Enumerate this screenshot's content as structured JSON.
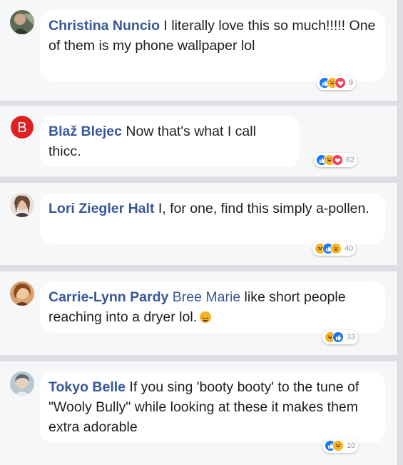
{
  "comments": [
    {
      "author": "Christina Nuncio",
      "text": " I literally love this so much!!!!! One of them is my phone wallpaper lol",
      "reactions": [
        "like",
        "haha",
        "love"
      ],
      "count": "9",
      "avatar_color": "#4a5a4a"
    },
    {
      "author": "Blaž Blejec",
      "text": " Now that's what I call thicc.",
      "reactions": [
        "like",
        "haha",
        "love"
      ],
      "count": "62",
      "avatar_color": "#e02020",
      "avatar_letter": "B"
    },
    {
      "author": "Lori Ziegler Halt",
      "text": " I, for one, find this simply a-pollen.",
      "reactions": [
        "haha",
        "like",
        "wow"
      ],
      "count": "40",
      "avatar_color": "#8a6a5a"
    },
    {
      "author": "Carrie-Lynn Pardy",
      "tag": "Bree Marie",
      "text": " like short people reaching into a dryer lol.",
      "reactions": [
        "haha",
        "like"
      ],
      "count": "33",
      "avatar_color": "#c08050"
    },
    {
      "author": "Tokyo Belle",
      "text": " If you sing 'booty booty' to the tune of \"Wooly Bully\" while looking at these it makes them extra adorable",
      "reactions": [
        "like",
        "haha"
      ],
      "count": "10",
      "avatar_color": "#7a9aaa"
    }
  ],
  "colors": {
    "name_blue": "#385898",
    "like_blue": "#1877f2",
    "haha_yellow": "#f7b125",
    "love_red": "#f33e58"
  }
}
